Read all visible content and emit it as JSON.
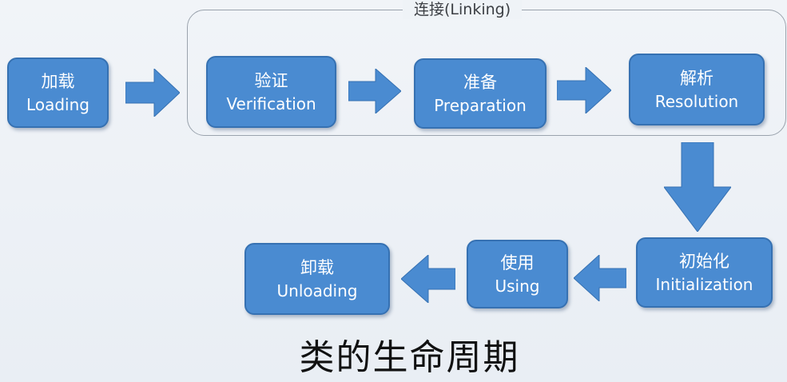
{
  "linking_group": {
    "label": "连接(Linking)"
  },
  "stages": {
    "loading": {
      "zh": "加载",
      "en": "Loading"
    },
    "verification": {
      "zh": "验证",
      "en": "Verification"
    },
    "preparation": {
      "zh": "准备",
      "en": "Preparation"
    },
    "resolution": {
      "zh": "解析",
      "en": "Resolution"
    },
    "initialization": {
      "zh": "初始化",
      "en": "Initialization"
    },
    "using": {
      "zh": "使用",
      "en": "Using"
    },
    "unloading": {
      "zh": "卸载",
      "en": "Unloading"
    }
  },
  "title": "类的生命周期",
  "colors": {
    "box_fill": "#4a8bd1",
    "box_border": "#3671b2",
    "arrow_fill": "#4a8bd1",
    "group_border": "#9aa3ad",
    "background": "#eef2f7"
  },
  "flow": [
    [
      "loading",
      "verification"
    ],
    [
      "verification",
      "preparation"
    ],
    [
      "preparation",
      "resolution"
    ],
    [
      "resolution",
      "initialization"
    ],
    [
      "initialization",
      "using"
    ],
    [
      "using",
      "unloading"
    ]
  ]
}
